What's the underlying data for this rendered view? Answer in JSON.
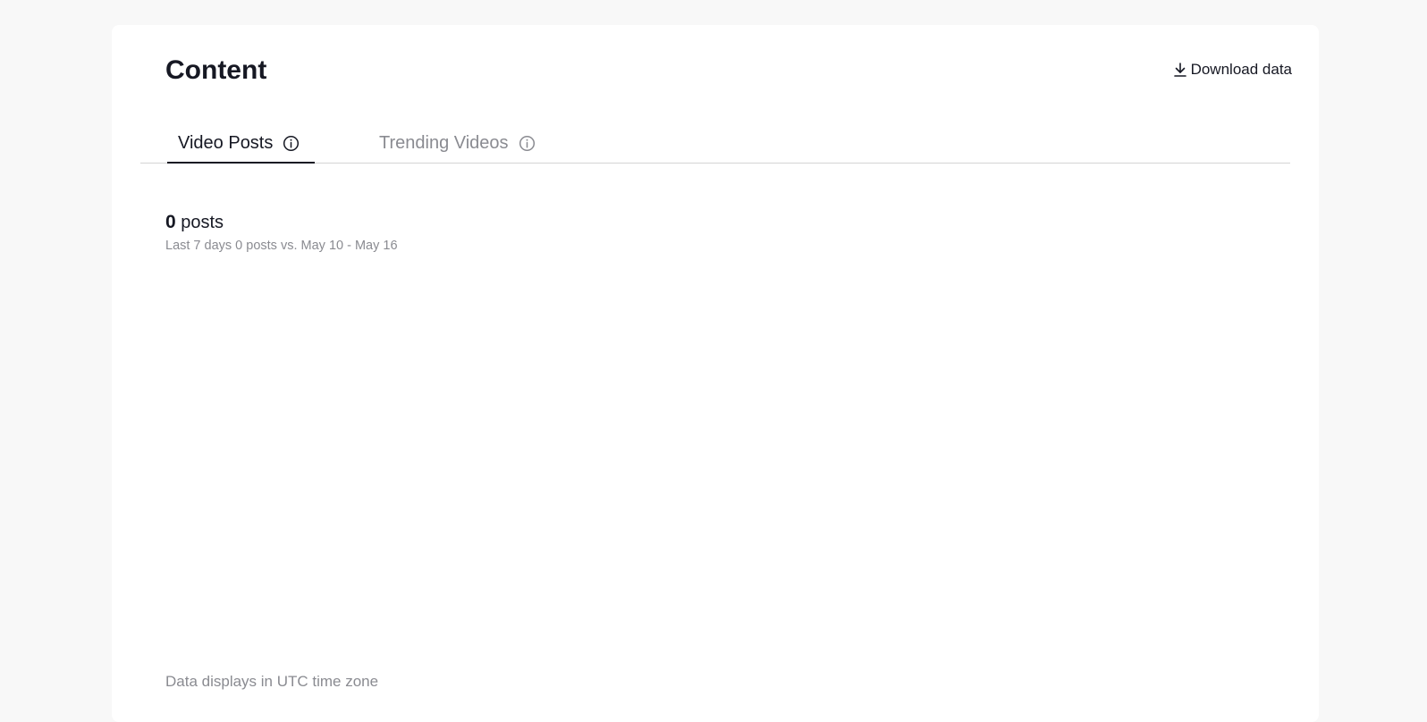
{
  "page": {
    "title": "Content",
    "download_label": "Download data"
  },
  "tabs": [
    {
      "label": "Video Posts",
      "active": true
    },
    {
      "label": "Trending Videos",
      "active": false
    }
  ],
  "summary": {
    "count": "0",
    "unit": "posts",
    "comparison": "Last 7 days 0 posts vs. May 10 - May 16"
  },
  "footer": {
    "timezone_note": "Data displays in UTC time zone"
  },
  "colors": {
    "text_primary": "#161823",
    "text_secondary": "#8a8b91",
    "divider": "#d4d4d4",
    "background": "#f8f8f8"
  },
  "icons": {
    "download": "download-arrow-icon",
    "info": "info-circle-icon"
  }
}
